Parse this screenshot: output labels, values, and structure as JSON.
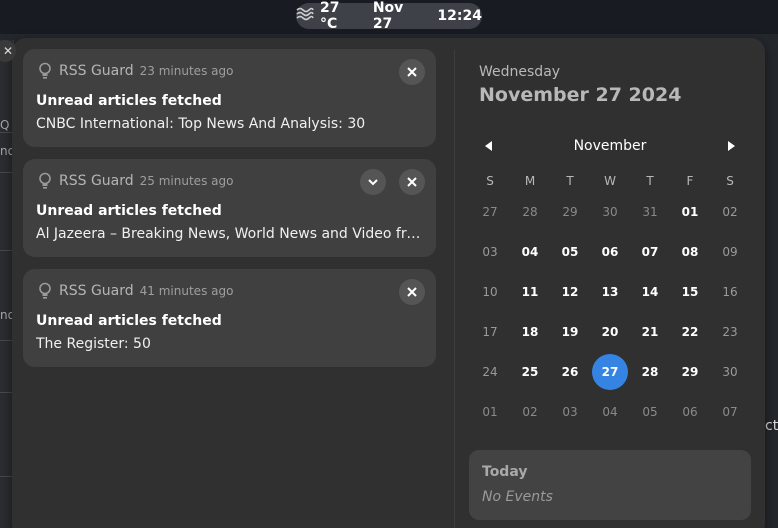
{
  "topbar": {
    "weather_icon": "fog-icon",
    "temperature": "27 °C",
    "date": "Nov 27",
    "time": "12:24"
  },
  "background": {
    "right_fragment": "ct",
    "left_fragments": [
      "Q",
      "no",
      "no"
    ]
  },
  "notifications": [
    {
      "icon": "lightbulb-icon",
      "app": "RSS Guard",
      "time": "23 minutes ago",
      "title": "Unread articles fetched",
      "body": "CNBC International: Top News And Analysis: 30",
      "expandable": false
    },
    {
      "icon": "lightbulb-icon",
      "app": "RSS Guard",
      "time": "25 minutes ago",
      "title": "Unread articles fetched",
      "body": "Al Jazeera – Breaking News, World News and Video from…",
      "expandable": true
    },
    {
      "icon": "lightbulb-icon",
      "app": "RSS Guard",
      "time": "41 minutes ago",
      "title": "Unread articles fetched",
      "body": "The Register: 50",
      "expandable": false
    }
  ],
  "calendar": {
    "weekday": "Wednesday",
    "full_date": "November 27 2024",
    "month": "November",
    "day_headers": [
      "S",
      "M",
      "T",
      "W",
      "T",
      "F",
      "S"
    ],
    "weeks": [
      [
        "27",
        "28",
        "29",
        "30",
        "31",
        "01",
        "02"
      ],
      [
        "03",
        "04",
        "05",
        "06",
        "07",
        "08",
        "09"
      ],
      [
        "10",
        "11",
        "12",
        "13",
        "14",
        "15",
        "16"
      ],
      [
        "17",
        "18",
        "19",
        "20",
        "21",
        "22",
        "23"
      ],
      [
        "24",
        "25",
        "26",
        "27",
        "28",
        "29",
        "30"
      ],
      [
        "01",
        "02",
        "03",
        "04",
        "05",
        "06",
        "07"
      ]
    ],
    "selected_day": "27",
    "accent_color": "#3584e4"
  },
  "events": {
    "title": "Today",
    "empty_text": "No Events"
  }
}
